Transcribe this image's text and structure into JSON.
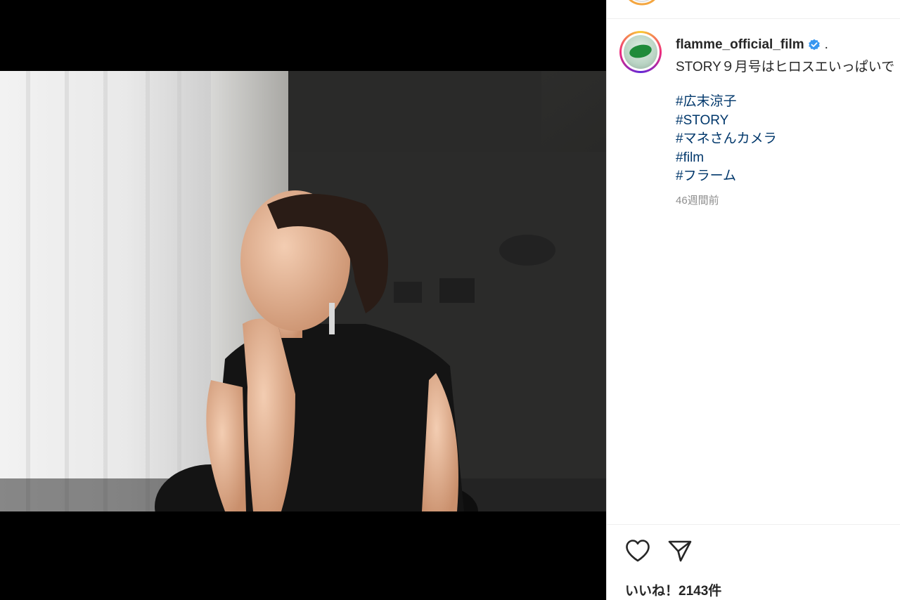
{
  "post": {
    "username": "flamme_official_film",
    "separator": ".",
    "caption": "STORY９月号はヒロスエいっぱいで",
    "hashtags": [
      "#広末涼子",
      "#STORY",
      "#マネさんカメラ",
      "#film",
      "#フラーム"
    ],
    "time_ago": "46週間前",
    "likes_label": "いいね！2143件"
  },
  "icons": {
    "verified": "verified-badge-icon",
    "like": "heart-icon",
    "share": "paper-plane-icon"
  },
  "colors": {
    "verified": "#3897f0",
    "hashtag": "#00376b",
    "text": "#262626",
    "muted": "#8e8e8e"
  }
}
